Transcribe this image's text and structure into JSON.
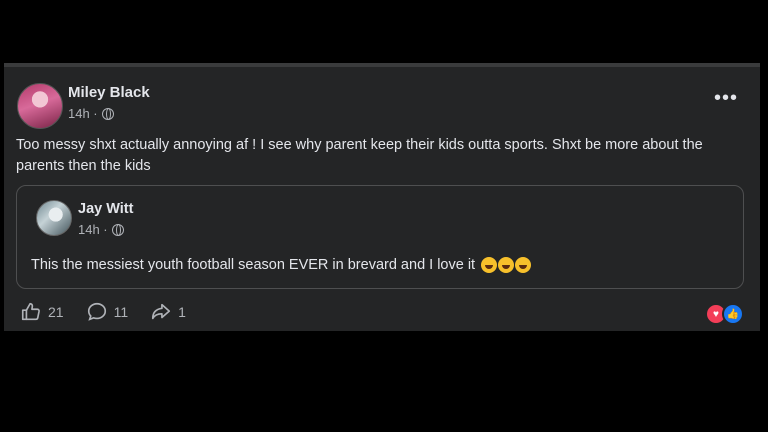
{
  "post": {
    "author": "Miley Black",
    "time": "14h ·",
    "more": "•••",
    "text": "Too messy shxt actually annoying af ! I see why parent keep their kids outta sports. Shxt be more about the parents then the kids",
    "shared": {
      "author": "Jay Witt",
      "time": "14h ·",
      "text": "This the messiest youth football season EVER in brevard and I love it",
      "emojis": [
        "rolling-on-floor-laughing",
        "rolling-on-floor-laughing",
        "rolling-on-floor-laughing"
      ]
    },
    "actions": {
      "like_count": "21",
      "comment_count": "11",
      "share_count": "1"
    },
    "reactions": [
      "love",
      "like"
    ],
    "colors": {
      "background": "#242526",
      "love": "#f33e58",
      "like": "#1877f2"
    }
  }
}
